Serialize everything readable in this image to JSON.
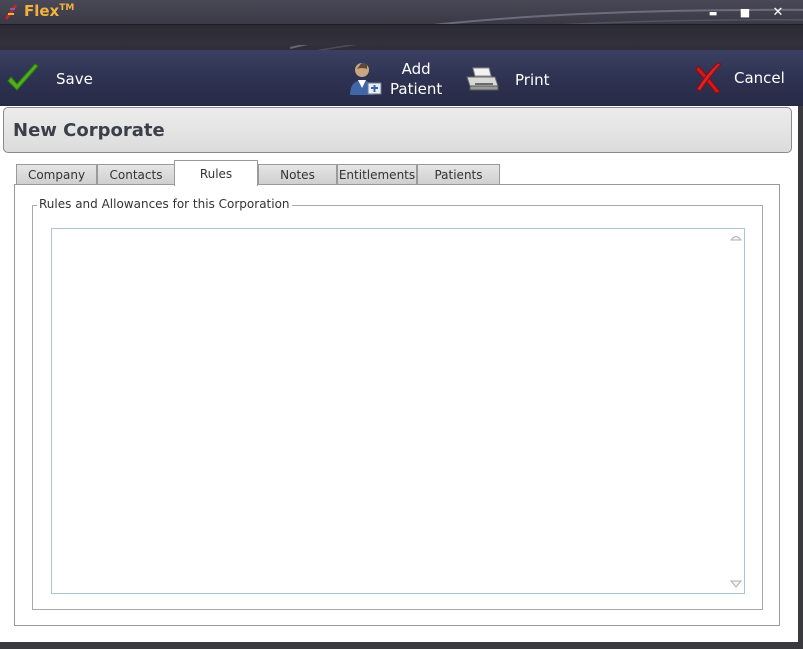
{
  "window": {
    "app_title": "Flex",
    "trademark": "TM",
    "minimize_label": "▬",
    "maximize_label": "■",
    "close_label": "✕"
  },
  "toolbar": {
    "save_label": "Save",
    "add_patient_line1": "Add",
    "add_patient_line2": "Patient",
    "print_label": "Print",
    "cancel_label": "Cancel"
  },
  "header": {
    "title": "New Corporate"
  },
  "tabs": [
    {
      "label": "Company",
      "active": false
    },
    {
      "label": "Contacts",
      "active": false
    },
    {
      "label": "Rules",
      "active": true
    },
    {
      "label": "Notes",
      "active": false
    },
    {
      "label": "Entitlements",
      "active": false
    },
    {
      "label": "Patients",
      "active": false
    }
  ],
  "rules_panel": {
    "group_label": "Rules and Allowances for this Corporation",
    "text_value": ""
  },
  "colors": {
    "title_accent": "#f2b33d",
    "toolbar_bg": "#2f3352",
    "save_check": "#4caf1f",
    "cancel_x": "#d3181c"
  }
}
